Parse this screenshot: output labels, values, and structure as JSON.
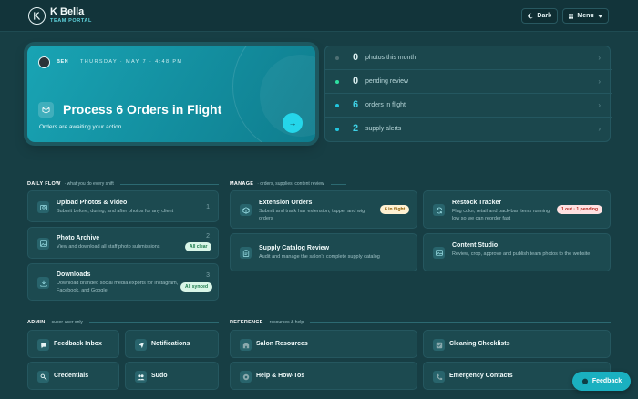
{
  "header": {
    "brand_name": "K Bella",
    "brand_sub": "TEAM PORTAL",
    "dark_label": "Dark",
    "menu_label": "Menu"
  },
  "hero": {
    "user": "BEN",
    "date": "THURSDAY · MAY 7 · 4:48 PM",
    "title": "Process 6 Orders in Flight",
    "subtitle": "Orders are awaiting your action."
  },
  "stats": [
    {
      "num": "0",
      "label": "photos this month",
      "dot": "#4e6f73",
      "color": "#dceff0"
    },
    {
      "num": "0",
      "label": "pending review",
      "dot": "#2ee0a0",
      "color": "#dceff0"
    },
    {
      "num": "6",
      "label": "orders in flight",
      "dot": "#22c7e0",
      "color": "#3fd0e4"
    },
    {
      "num": "2",
      "label": "supply alerts",
      "dot": "#22c7e0",
      "color": "#3fd0e4"
    }
  ],
  "sections": {
    "daily_flow": {
      "title": "DAILY FLOW",
      "sub": "· what you do every shift"
    },
    "manage": {
      "title": "MANAGE",
      "sub": "· orders, supplies, content review"
    },
    "admin": {
      "title": "ADMIN",
      "sub": "· super-user only"
    },
    "reference": {
      "title": "REFERENCE",
      "sub": "· resources & help"
    }
  },
  "daily": [
    {
      "title": "Upload Photos & Video",
      "desc": "Submit before, during, and after photos for any client",
      "num": "1"
    },
    {
      "title": "Photo Archive",
      "desc": "View and download all staff photo submissions",
      "num": "2",
      "badge": "All clear"
    },
    {
      "title": "Downloads",
      "desc": "Download branded social media exports for Instagram, Facebook, and Google",
      "num": "3",
      "badge": "All synced"
    }
  ],
  "manage": [
    {
      "title": "Extension Orders",
      "desc": "Submit and track hair extension, tapper and wig orders",
      "badge": "6 in flight"
    },
    {
      "title": "Restock Tracker",
      "desc": "Flag color, retail and back-bar items running low so we can reorder fast",
      "badge": "1 out · 1 pending"
    },
    {
      "title": "Supply Catalog Review",
      "desc": "Audit and manage the salon's complete supply catalog"
    },
    {
      "title": "Content Studio",
      "desc": "Review, crop, approve and publish team photos to the website"
    }
  ],
  "admin": [
    {
      "title": "Feedback Inbox"
    },
    {
      "title": "Notifications"
    },
    {
      "title": "Credentials"
    },
    {
      "title": "Sudo"
    }
  ],
  "reference": [
    {
      "title": "Salon Resources"
    },
    {
      "title": "Cleaning Checklists"
    },
    {
      "title": "Help & How-Tos"
    },
    {
      "title": "Emergency Contacts"
    }
  ],
  "feedback_label": "Feedback"
}
